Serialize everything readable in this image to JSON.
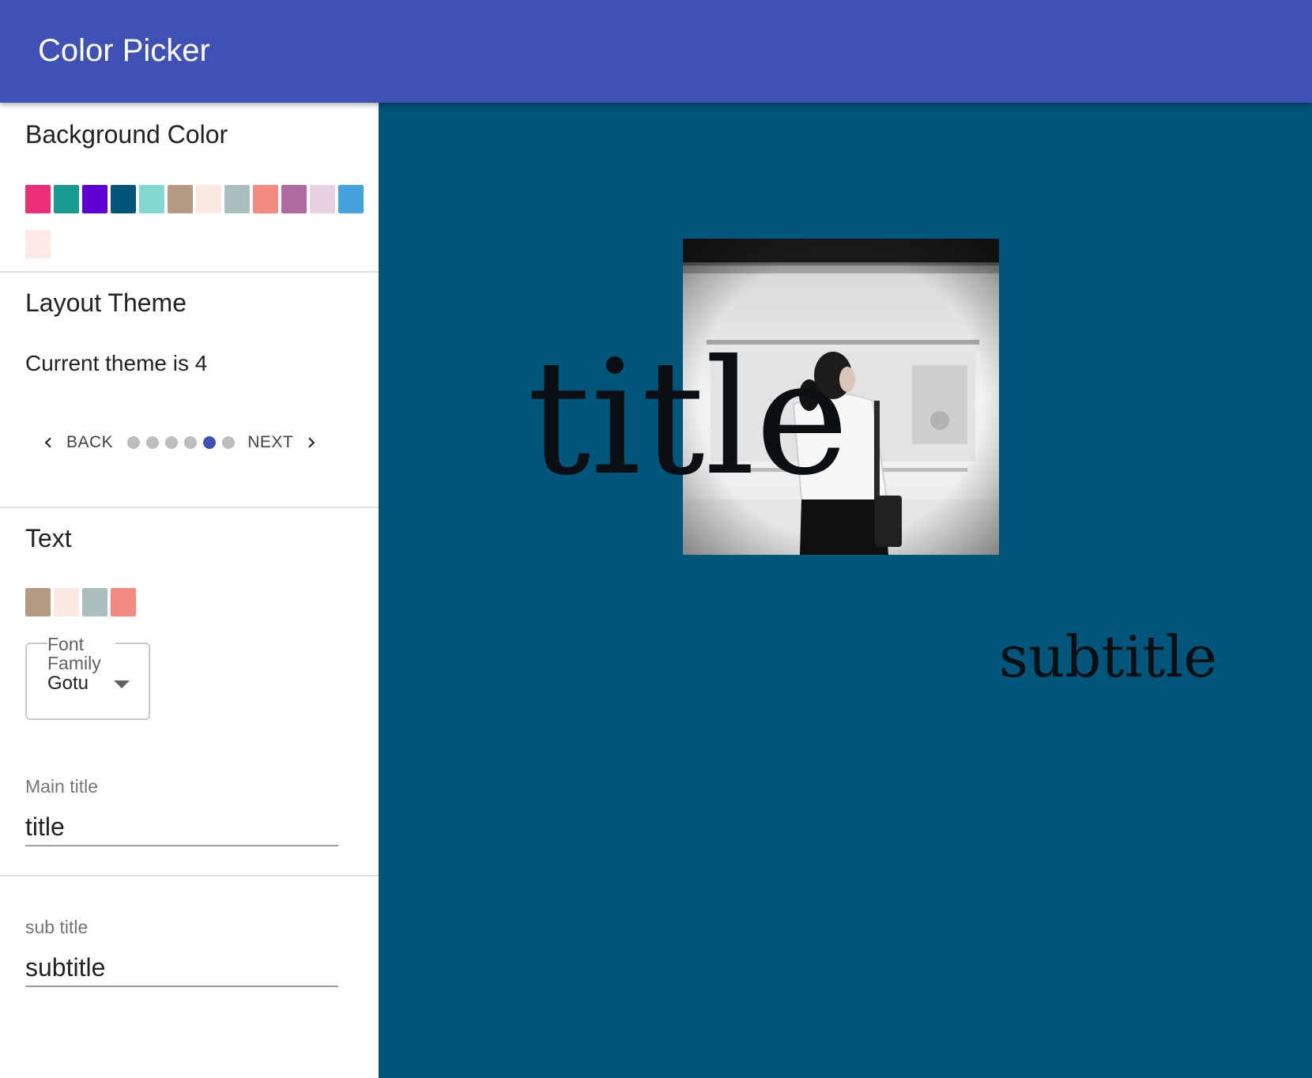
{
  "app": {
    "title": "Color Picker"
  },
  "colors": {
    "appbar": "#3f51b5",
    "preview_background": "#00557a",
    "accent": "#3f51b5"
  },
  "background_section": {
    "heading": "Background Color",
    "swatches": [
      "#ec2d7a",
      "#189a90",
      "#5c00d2",
      "#00557a",
      "#83d9ce",
      "#b59a82",
      "#fbe7df",
      "#a8bfbd",
      "#f48b82",
      "#ad6b9f",
      "#e7d2e2",
      "#43a4dd",
      "#ffeae5"
    ]
  },
  "layout_section": {
    "heading": "Layout Theme",
    "current_text": "Current theme is 4",
    "back_label": "BACK",
    "next_label": "NEXT",
    "step_count": 6,
    "active_step_index": 4
  },
  "text_section": {
    "heading": "Text",
    "swatches": [
      "#b59a82",
      "#fbe7df",
      "#a8bfbd",
      "#f48b82"
    ],
    "font_family": {
      "label": "Font Family",
      "value": "Gotu"
    },
    "main_title": {
      "label": "Main title",
      "value": "title"
    },
    "sub_title": {
      "label": "sub title",
      "value": "subtitle"
    }
  },
  "preview": {
    "title": "title",
    "subtitle": "subtitle"
  }
}
